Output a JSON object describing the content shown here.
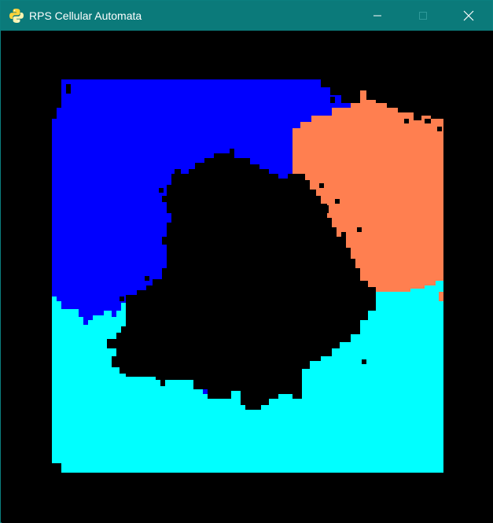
{
  "window": {
    "title": "RPS Cellular Automata",
    "icons": {
      "app": "python-icon",
      "minimize": "minimize-icon",
      "maximize": "maximize-icon",
      "close": "close-icon"
    }
  },
  "colors": {
    "titlebar": "#0b7a7a",
    "background": "#000000",
    "blue": "#0000ff",
    "orange": "#ff7f50",
    "cyan": "#00ffff",
    "black": "#000000"
  }
}
